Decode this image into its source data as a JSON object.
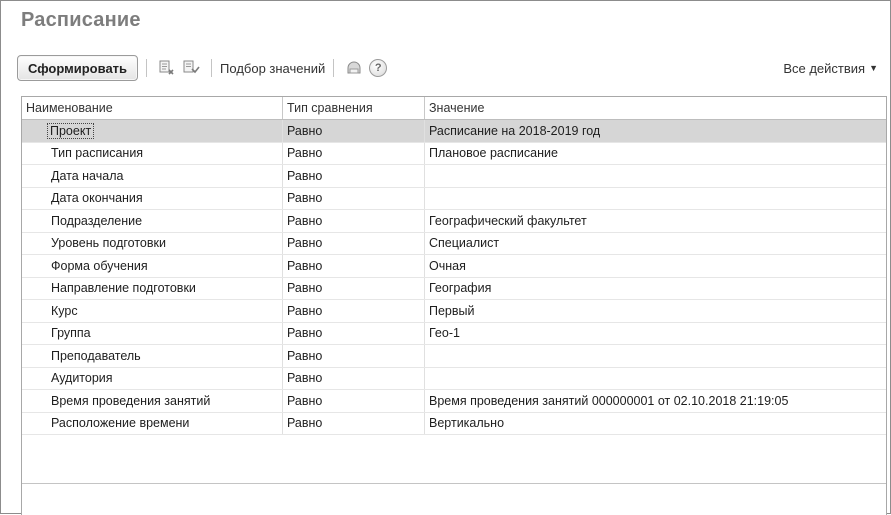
{
  "window": {
    "title": "Расписание"
  },
  "toolbar": {
    "generate_label": "Сформировать",
    "pick_values_label": "Подбор значений",
    "all_actions_label": "Все действия",
    "help_label": "?"
  },
  "grid": {
    "columns": [
      "Наименование",
      "Тип сравнения",
      "Значение"
    ],
    "rows": [
      {
        "name": "Проект",
        "comparison": "Равно",
        "value": "Расписание на 2018-2019 год"
      },
      {
        "name": "Тип расписания",
        "comparison": "Равно",
        "value": "Плановое расписание"
      },
      {
        "name": "Дата начала",
        "comparison": "Равно",
        "value": ""
      },
      {
        "name": "Дата окончания",
        "comparison": "Равно",
        "value": ""
      },
      {
        "name": "Подразделение",
        "comparison": "Равно",
        "value": "Географический факультет"
      },
      {
        "name": "Уровень подготовки",
        "comparison": "Равно",
        "value": "Специалист"
      },
      {
        "name": "Форма обучения",
        "comparison": "Равно",
        "value": "Очная"
      },
      {
        "name": "Направление подготовки",
        "comparison": "Равно",
        "value": "География"
      },
      {
        "name": "Курс",
        "comparison": "Равно",
        "value": "Первый"
      },
      {
        "name": "Группа",
        "comparison": "Равно",
        "value": "Гео-1"
      },
      {
        "name": "Преподаватель",
        "comparison": "Равно",
        "value": ""
      },
      {
        "name": "Аудитория",
        "comparison": "Равно",
        "value": ""
      },
      {
        "name": "Время проведения занятий",
        "comparison": "Равно",
        "value": "Время проведения занятий 000000001 от 02.10.2018 21:19:05"
      },
      {
        "name": "Расположение времени",
        "comparison": "Равно",
        "value": "Вертикально"
      }
    ],
    "selected_row": 0
  },
  "colors": {
    "title": "#7d7d7d",
    "selected_row": "#d6d6d6",
    "border": "#a8a8a8"
  }
}
